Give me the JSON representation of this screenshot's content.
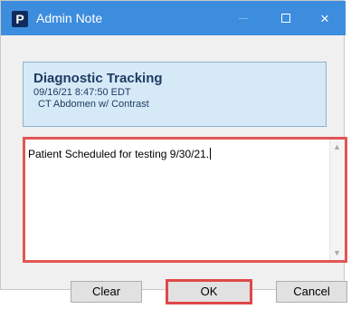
{
  "window": {
    "title": "Admin Note",
    "app_icon_letter": "P",
    "close_glyph": "×"
  },
  "header": {
    "title": "Diagnostic Tracking",
    "datetime": "09/16/21 8:47:50 EDT",
    "exam": "CT Abdomen w/ Contrast"
  },
  "note": {
    "text": "Patient Scheduled for testing 9/30/21."
  },
  "scrollbar": {
    "up_glyph": "▲",
    "down_glyph": "▼"
  },
  "buttons": {
    "clear": "Clear",
    "ok": "OK",
    "cancel": "Cancel"
  },
  "colors": {
    "titlebar": "#3d8ddf",
    "highlight_border": "#e35555",
    "header_panel": "#d6e9f7"
  }
}
